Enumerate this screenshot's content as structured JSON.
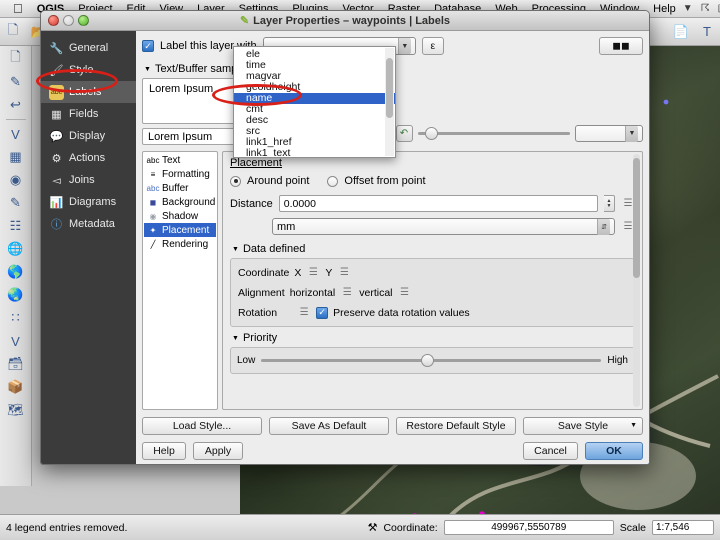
{
  "menubar": {
    "apple_icon": "apple-icon",
    "items": [
      "QGIS",
      "Project",
      "Edit",
      "View",
      "Layer",
      "Settings",
      "Plugins",
      "Vector",
      "Raster",
      "Database",
      "Web",
      "Processing",
      "Window",
      "Help"
    ],
    "status_icons": [
      "dropbox-icon",
      "sharing-icon",
      "display-icon",
      "timemachine-icon",
      "bluetooth-icon",
      "wifi-icon"
    ]
  },
  "dialog": {
    "title": "Layer Properties – waypoints | Labels",
    "title_icon": "labels-icon",
    "sidebar": [
      {
        "label": "General",
        "icon": "wrench-icon"
      },
      {
        "label": "Style",
        "icon": "brush-icon"
      },
      {
        "label": "Labels",
        "icon": "abc-icon",
        "active": true
      },
      {
        "label": "Fields",
        "icon": "table-icon"
      },
      {
        "label": "Display",
        "icon": "speech-bubble-icon"
      },
      {
        "label": "Actions",
        "icon": "gear-play-icon"
      },
      {
        "label": "Joins",
        "icon": "join-icon"
      },
      {
        "label": "Diagrams",
        "icon": "diagram-icon"
      },
      {
        "label": "Metadata",
        "icon": "info-icon"
      }
    ],
    "label_layer_with": {
      "checkbox_label": "Label this layer with",
      "checked": true,
      "value": "",
      "expression_button": "expression-icon"
    },
    "text_buffer_sample": {
      "section_label": "Text/Buffer sample",
      "sample_text": "Lorem Ipsum",
      "input_value": "Lorem Ipsum",
      "revert_icon": "revert-icon",
      "zoom_value": ""
    },
    "inner_tabs": [
      {
        "label": "Text",
        "icon": "abc-icon"
      },
      {
        "label": "Formatting",
        "icon": "formatting-icon"
      },
      {
        "label": "Buffer",
        "icon": "buffer-icon"
      },
      {
        "label": "Background",
        "icon": "background-icon"
      },
      {
        "label": "Shadow",
        "icon": "shadow-icon"
      },
      {
        "label": "Placement",
        "icon": "placement-icon",
        "active": true
      },
      {
        "label": "Rendering",
        "icon": "rendering-icon"
      }
    ],
    "placement": {
      "heading": "Placement",
      "mode_around": "Around point",
      "mode_offset": "Offset from point",
      "selected_mode": "Around point",
      "distance_label": "Distance",
      "distance_value": "0.0000",
      "units_value": "mm",
      "data_defined": {
        "heading": "Data defined",
        "coordinate_label": "Coordinate",
        "coordinate_x": "X",
        "coordinate_y": "Y",
        "alignment_label": "Alignment",
        "alignment_horizontal": "horizontal",
        "alignment_vertical": "vertical",
        "rotation_label": "Rotation",
        "preserve_rotation_label": "Preserve data rotation values",
        "preserve_rotation_checked": true
      },
      "priority": {
        "heading": "Priority",
        "low_label": "Low",
        "high_label": "High"
      }
    },
    "style_buttons": {
      "load_style": "Load Style...",
      "save_as_default": "Save As Default",
      "restore_default": "Restore Default Style",
      "save_style": "Save Style"
    },
    "action_buttons": {
      "help": "Help",
      "apply": "Apply",
      "cancel": "Cancel",
      "ok": "OK"
    }
  },
  "field_dropdown": {
    "open": true,
    "selected": "name",
    "items": [
      "ele",
      "time",
      "magvar",
      "geoidheight",
      "name",
      "cmt",
      "desc",
      "src",
      "link1_href",
      "link1_text"
    ]
  },
  "statusbar": {
    "message": "4 legend entries removed.",
    "render_icon": "render-icon",
    "coordinate_label": "Coordinate:",
    "coordinate_value": "499967,5550789",
    "scale_label": "Scale",
    "scale_value": "1:7,546"
  },
  "toolbars": {
    "left_icons": [
      "add-vector-layer-icon",
      "add-raster-layer-icon",
      "add-mesh-layer-icon",
      "add-delimited-text-layer-icon",
      "add-spatialite-layer-icon",
      "add-postgis-layer-icon",
      "add-wms-layer-icon",
      "add-wfs-layer-icon",
      "add-wcs-layer-icon",
      "new-shapefile-icon",
      "new-spatialite-icon",
      "new-geopackage-icon",
      "new-memory-layer-icon"
    ],
    "top_icons": [
      "new-project-icon",
      "open-project-icon",
      "save-project-icon",
      "undo-icon",
      "redo-icon",
      "annotation-icon",
      "text-annotation-icon"
    ],
    "right_button": "apply-color-icon"
  },
  "colors": {
    "accent_blue": "#2f63c8",
    "annotation_red": "#d81f18",
    "sidebar_dark": "#3b3b3b",
    "dialog_bg": "#ededed"
  }
}
